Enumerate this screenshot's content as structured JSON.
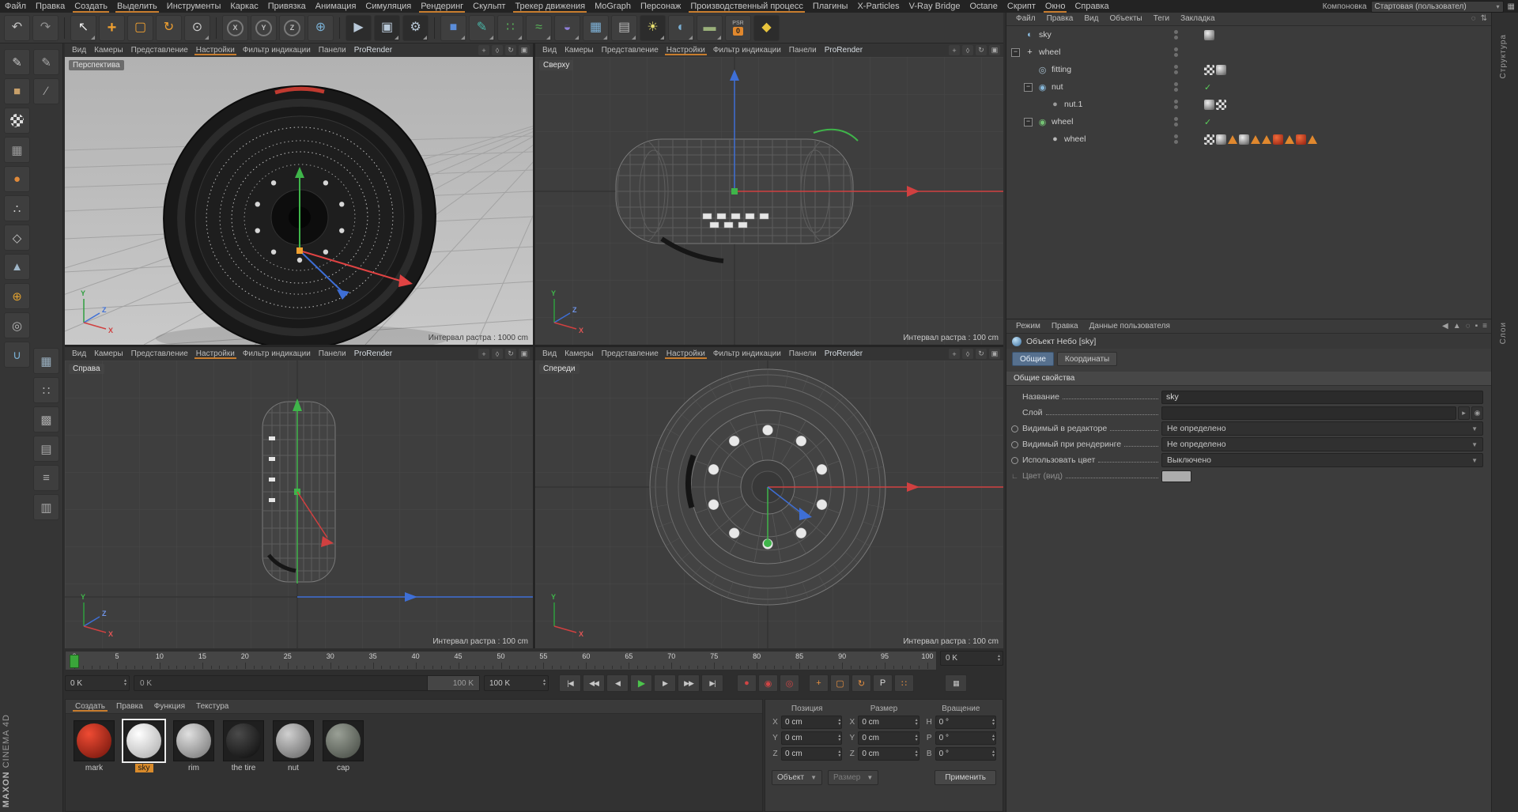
{
  "menubar": {
    "items": [
      {
        "label": "Файл"
      },
      {
        "label": "Правка"
      },
      {
        "label": "Создать",
        "accent": true
      },
      {
        "label": "Выделить",
        "accent": true
      },
      {
        "label": "Инструменты"
      },
      {
        "label": "Каркас"
      },
      {
        "label": "Привязка"
      },
      {
        "label": "Анимация"
      },
      {
        "label": "Симуляция"
      },
      {
        "label": "Рендеринг",
        "accent": true
      },
      {
        "label": "Скульпт"
      },
      {
        "label": "Трекер движения",
        "accent": true
      },
      {
        "label": "MoGraph"
      },
      {
        "label": "Персонаж"
      },
      {
        "label": "Производственный процесс",
        "accent": true
      },
      {
        "label": "Плагины"
      },
      {
        "label": "X-Particles"
      },
      {
        "label": "V-Ray Bridge"
      },
      {
        "label": "Octane"
      },
      {
        "label": "Скрипт"
      },
      {
        "label": "Окно",
        "accent": true
      },
      {
        "label": "Справка"
      }
    ],
    "layout_label": "Компоновка",
    "layout_value": "Стартовая (пользовател)",
    "layout_grid_glyph": "▦"
  },
  "toolbar": {
    "psr_text": "PSR",
    "psr_zero": "0",
    "tools": [
      {
        "name": "undo",
        "glyph": "↶",
        "color": "#c4c4c4"
      },
      {
        "name": "redo",
        "glyph": "↷",
        "color": "#8f8f8f"
      },
      {
        "sep": true
      },
      {
        "name": "live-selection",
        "glyph": "↖",
        "color": "#ececec",
        "dd": true
      },
      {
        "name": "move",
        "glyph": "+",
        "color": "#f0a030",
        "big": true
      },
      {
        "name": "scale",
        "glyph": "▢",
        "color": "#f0a030"
      },
      {
        "name": "rotate",
        "glyph": "↻",
        "color": "#f0a030"
      },
      {
        "name": "last-tool",
        "glyph": "⊙",
        "color": "#cccccc",
        "dd": true
      },
      {
        "sep": true
      },
      {
        "name": "lock-x",
        "glyph": "X",
        "ring": true
      },
      {
        "name": "lock-y",
        "glyph": "Y",
        "ring": true
      },
      {
        "name": "lock-z",
        "glyph": "Z",
        "ring": true
      },
      {
        "name": "coord-system",
        "glyph": "⊕",
        "color": "#7ab0d4"
      },
      {
        "sep": true
      },
      {
        "name": "render-view",
        "glyph": "▶",
        "color": "#b8c8d8",
        "chip": true
      },
      {
        "name": "render-picture-viewer",
        "glyph": "▣",
        "color": "#b8c8d8",
        "chip": true,
        "dd": true
      },
      {
        "name": "render-settings",
        "glyph": "⚙",
        "color": "#b8c8d8",
        "chip": true,
        "dd": true
      },
      {
        "sep": true
      },
      {
        "name": "primitive-cube",
        "glyph": "■",
        "color": "#5b8dd9",
        "dd": true
      },
      {
        "name": "spline-pen",
        "glyph": "✎",
        "color": "#49b6a8",
        "dd": true
      },
      {
        "name": "mograph-cloner",
        "glyph": "∷",
        "color": "#58b158",
        "dd": true
      },
      {
        "name": "simulation",
        "glyph": "≈",
        "color": "#58b158",
        "dd": true
      },
      {
        "name": "deformer",
        "glyph": "◒",
        "color": "#8f7fd9",
        "dd": true
      },
      {
        "name": "volume",
        "glyph": "▦",
        "color": "#7fb3d9",
        "dd": true
      },
      {
        "name": "camera",
        "glyph": "▤",
        "color": "#b8b8b8",
        "dd": true
      },
      {
        "name": "light",
        "glyph": "☀",
        "color": "#e8e070",
        "dd": true,
        "chip": true
      },
      {
        "name": "sky-environment",
        "glyph": "◐",
        "color": "#7ab0d4",
        "dd": true
      },
      {
        "name": "floor",
        "glyph": "▬",
        "color": "#9ab07a",
        "dd": true
      },
      {
        "name": "psr-reset",
        "psr": true
      },
      {
        "name": "autokey",
        "glyph": "◆",
        "color": "#e8c43d",
        "chip": true
      }
    ]
  },
  "left_palette": {
    "col1": [
      {
        "name": "make-editable",
        "glyph": "✎",
        "color": "#c8c8c8"
      },
      {
        "name": "model-mode",
        "glyph": "■",
        "color": "#c8a06a"
      },
      {
        "name": "texture-mode",
        "checker": true
      },
      {
        "name": "workplane-mode",
        "glyph": "▦",
        "color": "#9a9a9a"
      },
      {
        "name": "object-mode",
        "glyph": "●",
        "color": "#e08a3a"
      },
      {
        "name": "points-mode",
        "glyph": "∴",
        "color": "#c8c8c8"
      },
      {
        "name": "edges-mode",
        "glyph": "◇",
        "color": "#c8c8c8"
      },
      {
        "name": "polygons-mode",
        "glyph": "▲",
        "color": "#9fb6c8"
      },
      {
        "name": "axis-mode",
        "glyph": "⊕",
        "color": "#e0a030"
      },
      {
        "name": "solo-mode",
        "glyph": "◎",
        "color": "#b8b8b8"
      },
      {
        "name": "snap",
        "glyph": "∪",
        "color": "#7ab0d4"
      }
    ],
    "col2": [
      {
        "name": "sculpt-brush",
        "glyph": "✎",
        "color": "#a8a8a8"
      },
      {
        "name": "knife",
        "glyph": "∕",
        "color": "#a8a8a8"
      },
      {
        "spacer": 300
      },
      {
        "name": "array-grid",
        "glyph": "▦",
        "color": "#9ab0c0"
      },
      {
        "name": "matrix-grid",
        "glyph": "∷",
        "color": "#a8a8a8"
      },
      {
        "name": "lattice-grid",
        "glyph": "▩",
        "color": "#a8a8a8"
      },
      {
        "name": "plane-grid",
        "glyph": "▤",
        "color": "#a8a8a8"
      },
      {
        "name": "measure",
        "glyph": "≡",
        "color": "#a8a8a8"
      },
      {
        "name": "work-grid",
        "glyph": "▥",
        "color": "#a8a8a8"
      }
    ]
  },
  "viewport_menu": {
    "items": [
      {
        "label": "Вид"
      },
      {
        "label": "Камеры"
      },
      {
        "label": "Представление"
      },
      {
        "label": "Настройки",
        "accent": true
      },
      {
        "label": "Фильтр индикации"
      },
      {
        "label": "Панели"
      },
      {
        "label": "ProRender",
        "pro": true
      }
    ],
    "corner_icons": [
      {
        "name": "pan-view-icon",
        "glyph": "+"
      },
      {
        "name": "zoom-view-icon",
        "glyph": "◊"
      },
      {
        "name": "rotate-view-icon",
        "glyph": "↻"
      },
      {
        "name": "toggle-view-icon",
        "glyph": "▣"
      }
    ]
  },
  "viewports": {
    "perspective": {
      "label": "Перспектива",
      "status": "Интервал растра : 1000 cm"
    },
    "top": {
      "label": "Сверху",
      "status": "Интервал растра : 100 cm"
    },
    "right": {
      "label": "Справа",
      "status": "Интервал растра : 100 cm"
    },
    "front": {
      "label": "Спереди",
      "status": "Интервал растра : 100 cm"
    }
  },
  "timeline": {
    "tick_start": 0,
    "tick_end": 100,
    "tick_step": 5,
    "current_frame": 0,
    "end_spinner": "0 K",
    "start_field": "0 K",
    "end_field": "100 K",
    "range_from": "0 K",
    "range_to": "100 K",
    "layout_button_glyph": "▦",
    "transport": [
      {
        "name": "goto-start",
        "glyph": "|◀"
      },
      {
        "name": "prev-key",
        "glyph": "◀◀"
      },
      {
        "name": "prev-frame",
        "glyph": "◀"
      },
      {
        "name": "play",
        "glyph": "▶",
        "play": true
      },
      {
        "name": "next-frame",
        "glyph": "▶"
      },
      {
        "name": "next-key",
        "glyph": "▶▶"
      },
      {
        "name": "goto-end",
        "glyph": "▶|"
      }
    ],
    "record": [
      {
        "name": "record-keyframe",
        "glyph": "●",
        "color": "#d04545"
      },
      {
        "name": "autokeying",
        "glyph": "◉",
        "color": "#d04545"
      },
      {
        "name": "keyframe-selection",
        "glyph": "◎",
        "color": "#d04545"
      },
      {
        "gap": true
      },
      {
        "name": "record-position",
        "glyph": "+",
        "color": "#e89040"
      },
      {
        "name": "record-scale",
        "glyph": "▢",
        "color": "#e89040"
      },
      {
        "name": "record-rotation",
        "glyph": "↻",
        "color": "#e89040"
      },
      {
        "name": "record-parameter",
        "glyph": "P",
        "color": "#d8d8d8"
      },
      {
        "name": "record-pla",
        "glyph": "∷",
        "color": "#e89040"
      }
    ]
  },
  "materials": {
    "menu": [
      {
        "label": "Создать",
        "accent": true
      },
      {
        "label": "Правка"
      },
      {
        "label": "Функция"
      },
      {
        "label": "Текстура"
      }
    ],
    "items": [
      {
        "name": "mark",
        "c1": "#ef4b33",
        "c2": "#6b120a"
      },
      {
        "name": "sky",
        "c1": "#ffffff",
        "c2": "#a8a8a8",
        "selected": true
      },
      {
        "name": "rim",
        "c1": "#e0e0e0",
        "c2": "#707070"
      },
      {
        "name": "the tire",
        "c1": "#4a4a4a",
        "c2": "#0a0a0a"
      },
      {
        "name": "nut",
        "c1": "#d0d0d0",
        "c2": "#606060"
      },
      {
        "name": "cap",
        "c1": "#9aa096",
        "c2": "#41463f"
      }
    ]
  },
  "coords": {
    "headers": [
      "Позиция",
      "Размер",
      "Вращение"
    ],
    "axis_pos": [
      "X",
      "Y",
      "Z"
    ],
    "axis_rot": [
      "H",
      "P",
      "B"
    ],
    "position": [
      "0 cm",
      "0 cm",
      "0 cm"
    ],
    "size": [
      "0 cm",
      "0 cm",
      "0 cm"
    ],
    "rotation": [
      "0 °",
      "0 °",
      "0 °"
    ],
    "object_select": "Объект",
    "size_select": "Размер",
    "apply": "Применить"
  },
  "object_manager": {
    "menu": [
      "Файл",
      "Правка",
      "Вид",
      "Объекты",
      "Теги",
      "Закладка"
    ],
    "right_icons": [
      {
        "name": "search-icon",
        "glyph": "◌"
      },
      {
        "name": "sort-icon",
        "glyph": "⇅"
      }
    ],
    "rows": [
      {
        "name": "sky",
        "depth": 0,
        "glyph": "◐",
        "iconColor": "#8fc3e8",
        "tags": [
          "sphere"
        ]
      },
      {
        "name": "wheel",
        "depth": 0,
        "glyph": "+",
        "iconColor": "#d8d8d8",
        "expand": true
      },
      {
        "name": "fitting",
        "depth": 1,
        "glyph": "◎",
        "iconColor": "#a8c0d0",
        "tags": [
          "checker",
          "sphere"
        ]
      },
      {
        "name": "nut",
        "depth": 1,
        "glyph": "◉",
        "iconColor": "#86b6d8",
        "expand": true,
        "check": true
      },
      {
        "name": "nut.1",
        "depth": 2,
        "glyph": "●",
        "iconColor": "#9a9a9a",
        "tags": [
          "sphere",
          "checker"
        ]
      },
      {
        "name": "wheel",
        "depth": 1,
        "glyph": "◉",
        "iconColor": "#74c274",
        "expand": true,
        "check": true
      },
      {
        "name": "wheel",
        "depth": 2,
        "glyph": "●",
        "iconColor": "#b8b8b8",
        "tags": [
          "checker",
          "sphere",
          "tri",
          "sphere",
          "tri",
          "tri",
          "red",
          "tri",
          "red",
          "tri"
        ]
      }
    ]
  },
  "attributes": {
    "menu": [
      "Режим",
      "Правка",
      "Данные пользователя"
    ],
    "right_icons": [
      {
        "name": "back-icon",
        "glyph": "◀"
      },
      {
        "name": "up-icon",
        "glyph": "▲"
      },
      {
        "name": "search-icon",
        "glyph": "◌"
      },
      {
        "name": "lock-icon",
        "glyph": "▪"
      },
      {
        "name": "menu-icon",
        "glyph": "≡"
      }
    ],
    "title": "Объект Небо [sky]",
    "tabs": [
      {
        "label": "Общие",
        "active": true
      },
      {
        "label": "Координаты",
        "active": false
      }
    ],
    "section": "Общие свойства",
    "rows": [
      {
        "label": "Название",
        "type": "text",
        "value": "sky"
      },
      {
        "label": "Слой",
        "type": "layer",
        "value": ""
      },
      {
        "label": "Видимый в редакторе",
        "type": "select",
        "value": "Не определено",
        "anim": true
      },
      {
        "label": "Видимый при рендеринге",
        "type": "select",
        "value": "Не определено",
        "anim": true
      },
      {
        "label": "Использовать цвет",
        "type": "select",
        "value": "Выключено",
        "anim": true
      },
      {
        "label": "Цвет (вид)",
        "type": "color",
        "value": "",
        "sub": true
      }
    ]
  },
  "side_tabs": [
    "Структура",
    "Слои"
  ],
  "brand": {
    "maxon": "MAXON",
    "cinema": "CINEMA 4D"
  }
}
